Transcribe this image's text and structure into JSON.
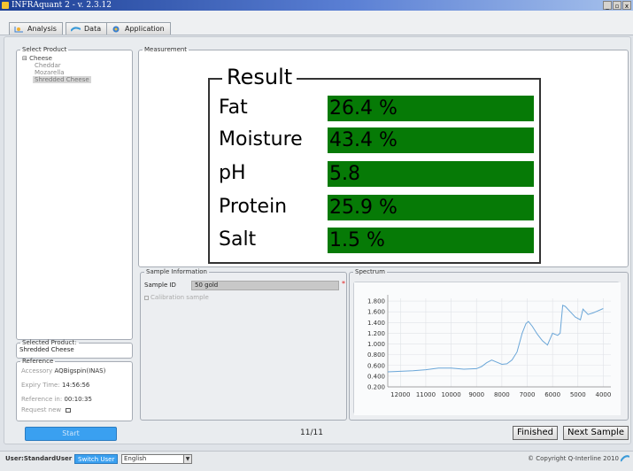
{
  "window": {
    "title": "INFRAquant 2 - v. 2.3.12",
    "minimize": "_",
    "restore": "▫",
    "close": "x"
  },
  "tabs": [
    {
      "label": "Analysis",
      "icon": "analysis-icon"
    },
    {
      "label": "Data",
      "icon": "data-icon"
    },
    {
      "label": "Application",
      "icon": "application-icon"
    }
  ],
  "sidebar": {
    "select_product_legend": "Select Product",
    "tree_root": "⊟ Cheese",
    "tree_items": [
      "Cheddar",
      "Mozarella",
      "Shredded Cheese"
    ],
    "selected_product_legend": "Selected Product:",
    "selected_product_value": "Shredded Cheese",
    "reference_legend": "Reference",
    "accessory_label": "Accessory",
    "accessory_value": "AQBigspin(INAS)",
    "expiry_label": "Expiry Time:",
    "expiry_value": "14:56:56",
    "reference_in_label": "Reference in:",
    "reference_in_value": "00:10:35",
    "request_new_label": "Request new",
    "start_button": "Start"
  },
  "measurement": {
    "legend": "Measurement",
    "result_title": "Result",
    "results": [
      {
        "label": "Fat",
        "value": "26.4 %"
      },
      {
        "label": "Moisture",
        "value": "43.4 %"
      },
      {
        "label": "pH",
        "value": "5.8"
      },
      {
        "label": "Protein",
        "value": "25.9 %"
      },
      {
        "label": "Salt",
        "value": "1.5 %"
      }
    ],
    "colors": {
      "result_bg": "#067a06"
    }
  },
  "sample_info": {
    "legend": "Sample Information",
    "sample_id_label": "Sample ID",
    "sample_id_value": "50 gold",
    "required_mark": "*",
    "calibration_label": "Calibration sample"
  },
  "spectrum": {
    "legend": "Spectrum",
    "chart_data": {
      "type": "line",
      "x_ticks": [
        12000,
        11000,
        10000,
        9000,
        8000,
        7000,
        6000,
        5000,
        4000
      ],
      "y_ticks": [
        "1.800",
        "1.600",
        "1.400",
        "1.200",
        "1.000",
        "0.800",
        "0.600",
        "0.400",
        "0.200"
      ],
      "xlim": [
        12500,
        3700
      ],
      "ylim": [
        0.2,
        1.85
      ],
      "x_reversed": true,
      "grid": true,
      "series": [
        {
          "color": "#6aa6d8",
          "points": [
            [
              12500,
              0.48
            ],
            [
              12000,
              0.49
            ],
            [
              11500,
              0.5
            ],
            [
              11000,
              0.52
            ],
            [
              10500,
              0.55
            ],
            [
              10000,
              0.55
            ],
            [
              9500,
              0.53
            ],
            [
              9000,
              0.54
            ],
            [
              8800,
              0.58
            ],
            [
              8600,
              0.65
            ],
            [
              8400,
              0.7
            ],
            [
              8200,
              0.66
            ],
            [
              8000,
              0.62
            ],
            [
              7800,
              0.63
            ],
            [
              7600,
              0.7
            ],
            [
              7400,
              0.85
            ],
            [
              7200,
              1.2
            ],
            [
              7050,
              1.38
            ],
            [
              6950,
              1.42
            ],
            [
              6800,
              1.33
            ],
            [
              6600,
              1.18
            ],
            [
              6400,
              1.06
            ],
            [
              6200,
              0.98
            ],
            [
              6000,
              1.2
            ],
            [
              5800,
              1.16
            ],
            [
              5700,
              1.2
            ],
            [
              5600,
              1.72
            ],
            [
              5500,
              1.7
            ],
            [
              5300,
              1.6
            ],
            [
              5100,
              1.5
            ],
            [
              4900,
              1.45
            ],
            [
              4800,
              1.65
            ],
            [
              4600,
              1.55
            ],
            [
              4400,
              1.58
            ],
            [
              4000,
              1.66
            ]
          ]
        }
      ]
    }
  },
  "footer": {
    "progress": "11/11",
    "finished_button": "Finished",
    "next_sample_button": "Next Sample"
  },
  "statusbar": {
    "user": "User:StandardUser",
    "switch_user": "Switch User",
    "language": "English",
    "copyright": "© Copyright Q-Interline 2010"
  }
}
